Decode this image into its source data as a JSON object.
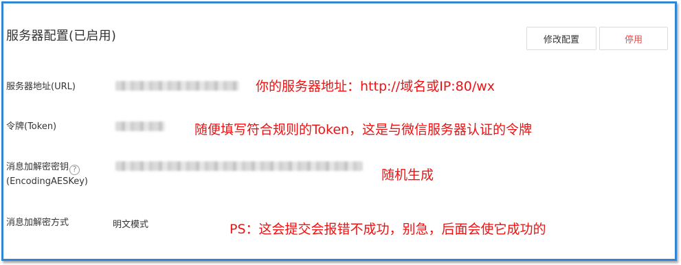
{
  "panel": {
    "title": "服务器配置(已启用)",
    "edit_button": "修改配置",
    "disable_button": "停用"
  },
  "fields": {
    "url_label": "服务器地址(URL)",
    "token_label": "令牌(Token)",
    "aes_label_line1": "消息加解密密钥",
    "aes_label_line2": "(EncodingAESKey)",
    "mode_label": "消息加解密方式",
    "mode_value": "明文模式"
  },
  "annotations": {
    "url_note": "你的服务器地址：http://域名或IP:80/wx",
    "token_note": "随便填写符合规则的Token，这是与微信服务器认证的令牌",
    "aes_note": "随机生成",
    "ps_note": "PS：这会提交会报错不成功，别急，后面会使它成功的"
  },
  "icons": {
    "help": "question-circle-icon"
  },
  "colors": {
    "frame_border": "#2f86d6",
    "annotation": "#ee1111",
    "disable_text": "#d9534f"
  }
}
